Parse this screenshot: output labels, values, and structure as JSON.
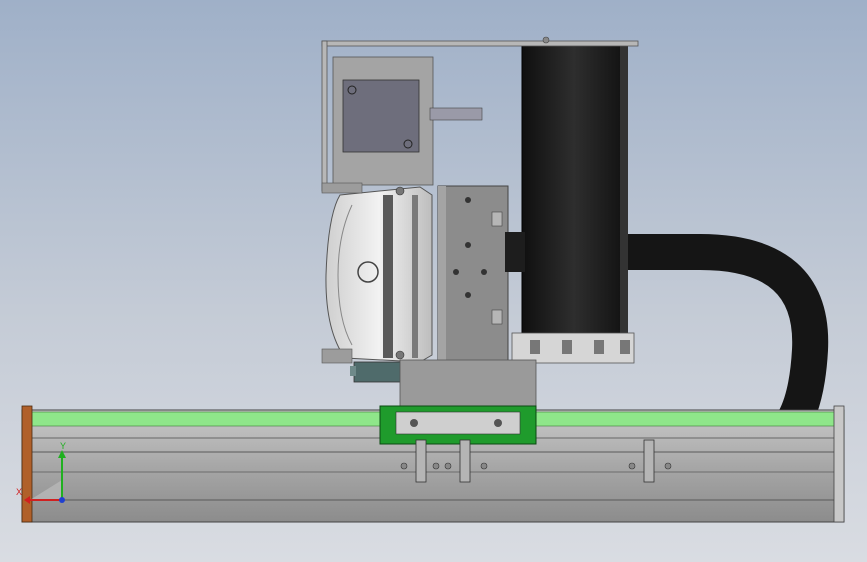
{
  "viewport": {
    "background_top": "#9fb0c8",
    "background_bottom": "#d9dce2"
  },
  "model": {
    "rail_accent_color": "#8fe68a",
    "carriage_color": "#1f9b2c",
    "end_cap_color": "#b0602a",
    "cable_color": "#1a1a1a",
    "motor_color": "#6b6b78"
  },
  "triad": {
    "x_label": "X",
    "y_label": "Y",
    "x_color": "#d02020",
    "y_color": "#20b020",
    "z_color": "#2040d0"
  }
}
